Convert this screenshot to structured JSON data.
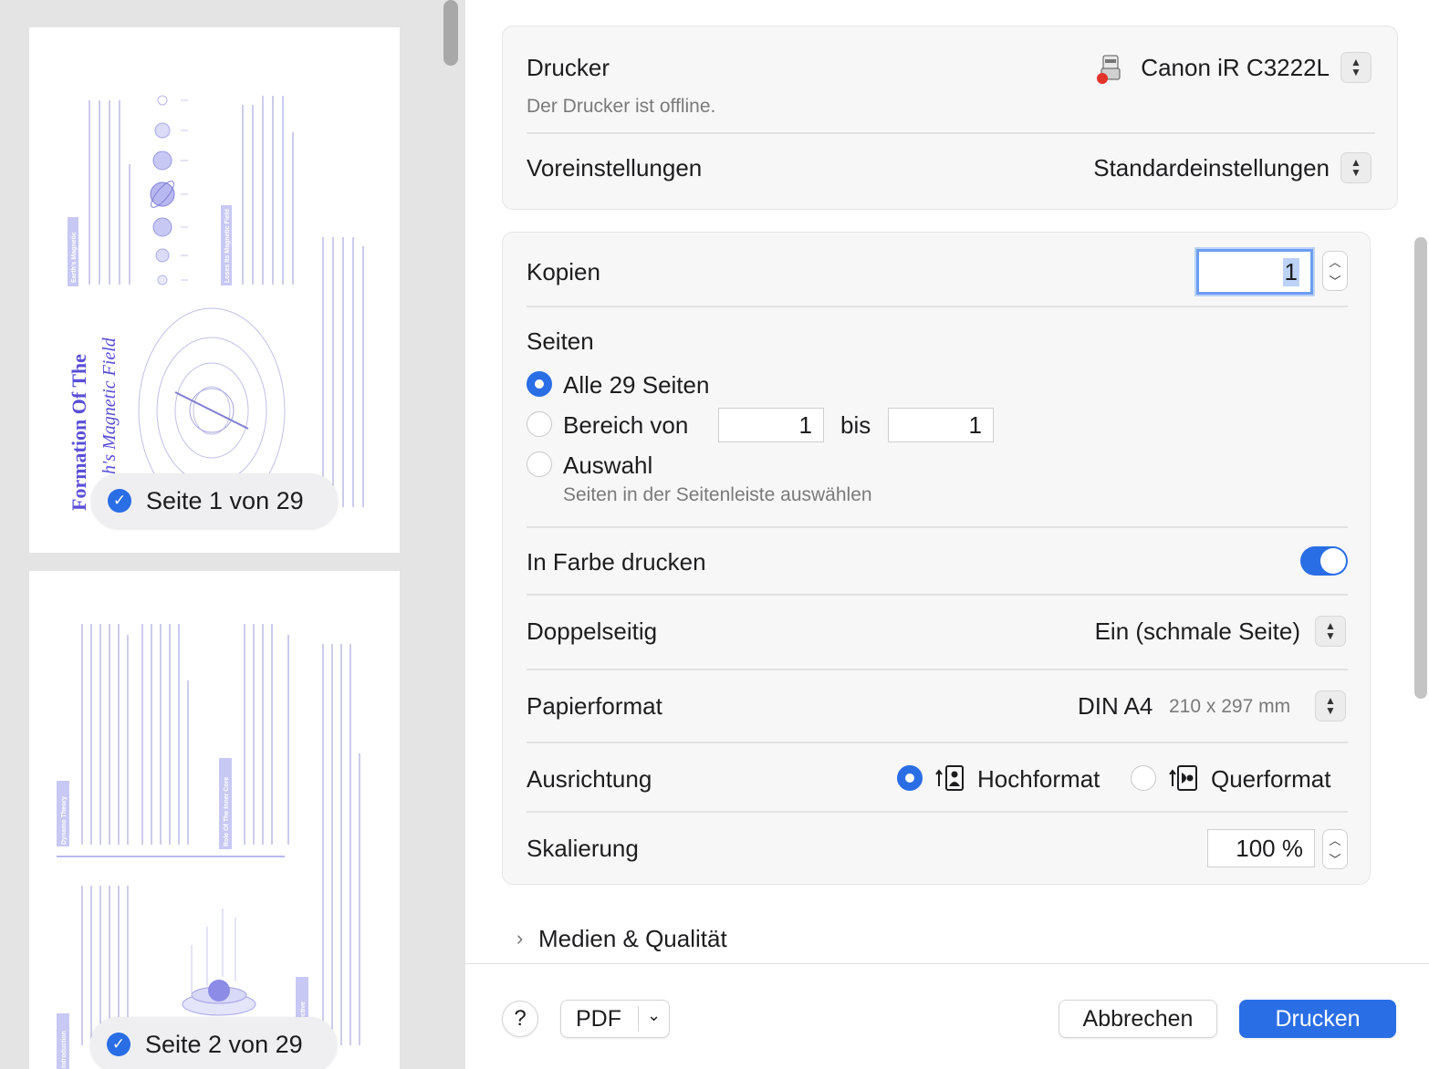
{
  "sidebar": {
    "pages": [
      {
        "label": "Seite 1 von 29",
        "title_line1": "Formation Of The",
        "title_line2": "h's Magnetic Field",
        "section_a": "Earth's Magnetic",
        "section_b": "Loses Its Magnetic Field"
      },
      {
        "label": "Seite 2 von 29",
        "section_a": "Dynamo Theory",
        "section_b": "Role Of The Inner Core",
        "section_c": "Introduction",
        "section_d": "spective"
      }
    ]
  },
  "printer": {
    "label": "Drucker",
    "name": "Canon iR C3222L",
    "status": "Der Drucker ist offline.",
    "icon": "printer-icon"
  },
  "presets": {
    "label": "Voreinstellungen",
    "value": "Standardeinstellungen"
  },
  "copies": {
    "label": "Kopien",
    "value": "1"
  },
  "pages": {
    "label": "Seiten",
    "all": "Alle 29 Seiten",
    "range": "Bereich von",
    "range_from": "1",
    "range_to_label": "bis",
    "range_to": "1",
    "selection": "Auswahl",
    "selection_hint": "Seiten in der Seitenleiste auswählen",
    "selected": "all"
  },
  "color": {
    "label": "In Farbe drucken",
    "enabled": true
  },
  "duplex": {
    "label": "Doppelseitig",
    "value": "Ein (schmale Seite)"
  },
  "paper": {
    "label": "Papierformat",
    "value": "DIN A4",
    "dimensions": "210 x 297 mm"
  },
  "orientation": {
    "label": "Ausrichtung",
    "portrait": "Hochformat",
    "landscape": "Querformat",
    "selected": "portrait"
  },
  "scaling": {
    "label": "Skalierung",
    "value": "100 %"
  },
  "media": {
    "label": "Medien & Qualität"
  },
  "footer": {
    "help": "?",
    "pdf": "PDF",
    "cancel": "Abbrechen",
    "print": "Drucken"
  },
  "colors": {
    "accent": "#2a6ee6",
    "thumb_text": "#5a5ac8"
  }
}
